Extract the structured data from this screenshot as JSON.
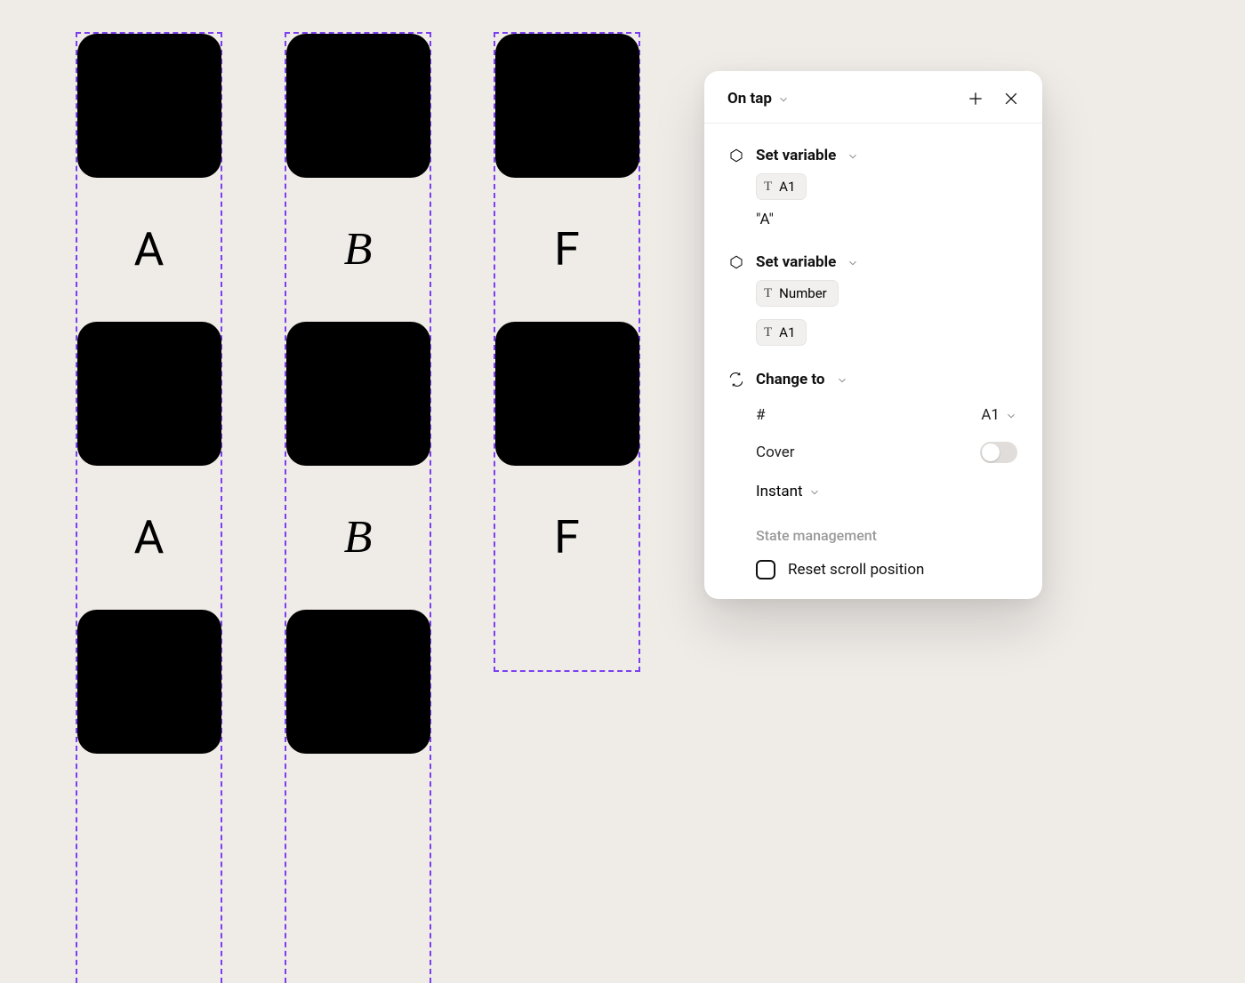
{
  "canvas": {
    "columns": [
      {
        "letter": "A",
        "style": "sans",
        "length": "long"
      },
      {
        "letter": "B",
        "style": "serif-italic",
        "length": "long"
      },
      {
        "letter": "F",
        "style": "sans",
        "length": "short"
      }
    ]
  },
  "panel": {
    "title": "On tap",
    "actions": [
      {
        "type": "set_variable",
        "label": "Set variable",
        "variable_pill": "A1",
        "literal_value": "\"A\""
      },
      {
        "type": "set_variable",
        "label": "Set variable",
        "variable_pill": "Number",
        "value_pill": "A1"
      },
      {
        "type": "change_to",
        "label": "Change to",
        "hash_label": "#",
        "target_value": "A1",
        "cover_label": "Cover",
        "cover_on": false,
        "animation": "Instant",
        "state_heading": "State management",
        "reset_label": "Reset scroll position",
        "reset_checked": false
      }
    ]
  }
}
